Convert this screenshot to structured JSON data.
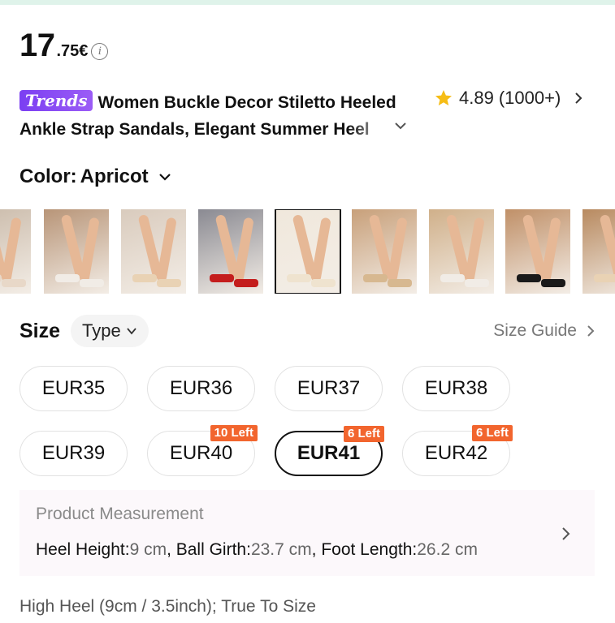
{
  "price": {
    "integer": "17",
    "decimal": ".75€",
    "info_icon": "info-icon"
  },
  "title": {
    "badge": "Trends",
    "text": "Women Buckle Decor Stiletto Heeled Ankle Strap Sandals, Elegant Summer Heel"
  },
  "rating": {
    "score": "4.89",
    "count": "(1000+)",
    "star_color": "#f6bd16"
  },
  "color": {
    "label": "Color:",
    "value": "Apricot"
  },
  "thumbnails": [
    {
      "name": "thumb-1",
      "shoe_color": "#e8d8c8",
      "selected": false
    },
    {
      "name": "thumb-2",
      "shoe_color": "#f1ece6",
      "selected": false
    },
    {
      "name": "thumb-3",
      "shoe_color": "#e9d2b4",
      "selected": false
    },
    {
      "name": "thumb-4",
      "shoe_color": "#c41d1d",
      "selected": false
    },
    {
      "name": "thumb-5",
      "shoe_color": "#efe3cf",
      "selected": true
    },
    {
      "name": "thumb-6",
      "shoe_color": "#d7b890",
      "selected": false
    },
    {
      "name": "thumb-7",
      "shoe_color": "#f1ece6",
      "selected": false
    },
    {
      "name": "thumb-8",
      "shoe_color": "#1a1a1a",
      "selected": false
    },
    {
      "name": "thumb-9",
      "shoe_color": "#e9d2b4",
      "selected": false
    }
  ],
  "size": {
    "label": "Size",
    "type_label": "Type",
    "guide_label": "Size Guide",
    "options": [
      {
        "label": "EUR35",
        "stock": "",
        "selected": false
      },
      {
        "label": "EUR36",
        "stock": "",
        "selected": false
      },
      {
        "label": "EUR37",
        "stock": "",
        "selected": false
      },
      {
        "label": "EUR38",
        "stock": "",
        "selected": false
      },
      {
        "label": "EUR39",
        "stock": "",
        "selected": false
      },
      {
        "label": "EUR40",
        "stock": "10 Left",
        "selected": false
      },
      {
        "label": "EUR41",
        "stock": "6 Left",
        "selected": true
      },
      {
        "label": "EUR42",
        "stock": "6 Left",
        "selected": false
      }
    ]
  },
  "measurement": {
    "title": "Product Measurement",
    "heel_label": "Heel Height:",
    "heel_value": "9 cm",
    "ball_label": "Ball Girth:",
    "ball_value": "23.7 cm",
    "foot_label": "Foot Length:",
    "foot_value": "26.2 cm"
  },
  "heel_note": "High Heel (9cm / 3.5inch); True To Size",
  "colors": {
    "accent_purple": "#8b4cf5",
    "stock_badge": "#f2652e"
  }
}
